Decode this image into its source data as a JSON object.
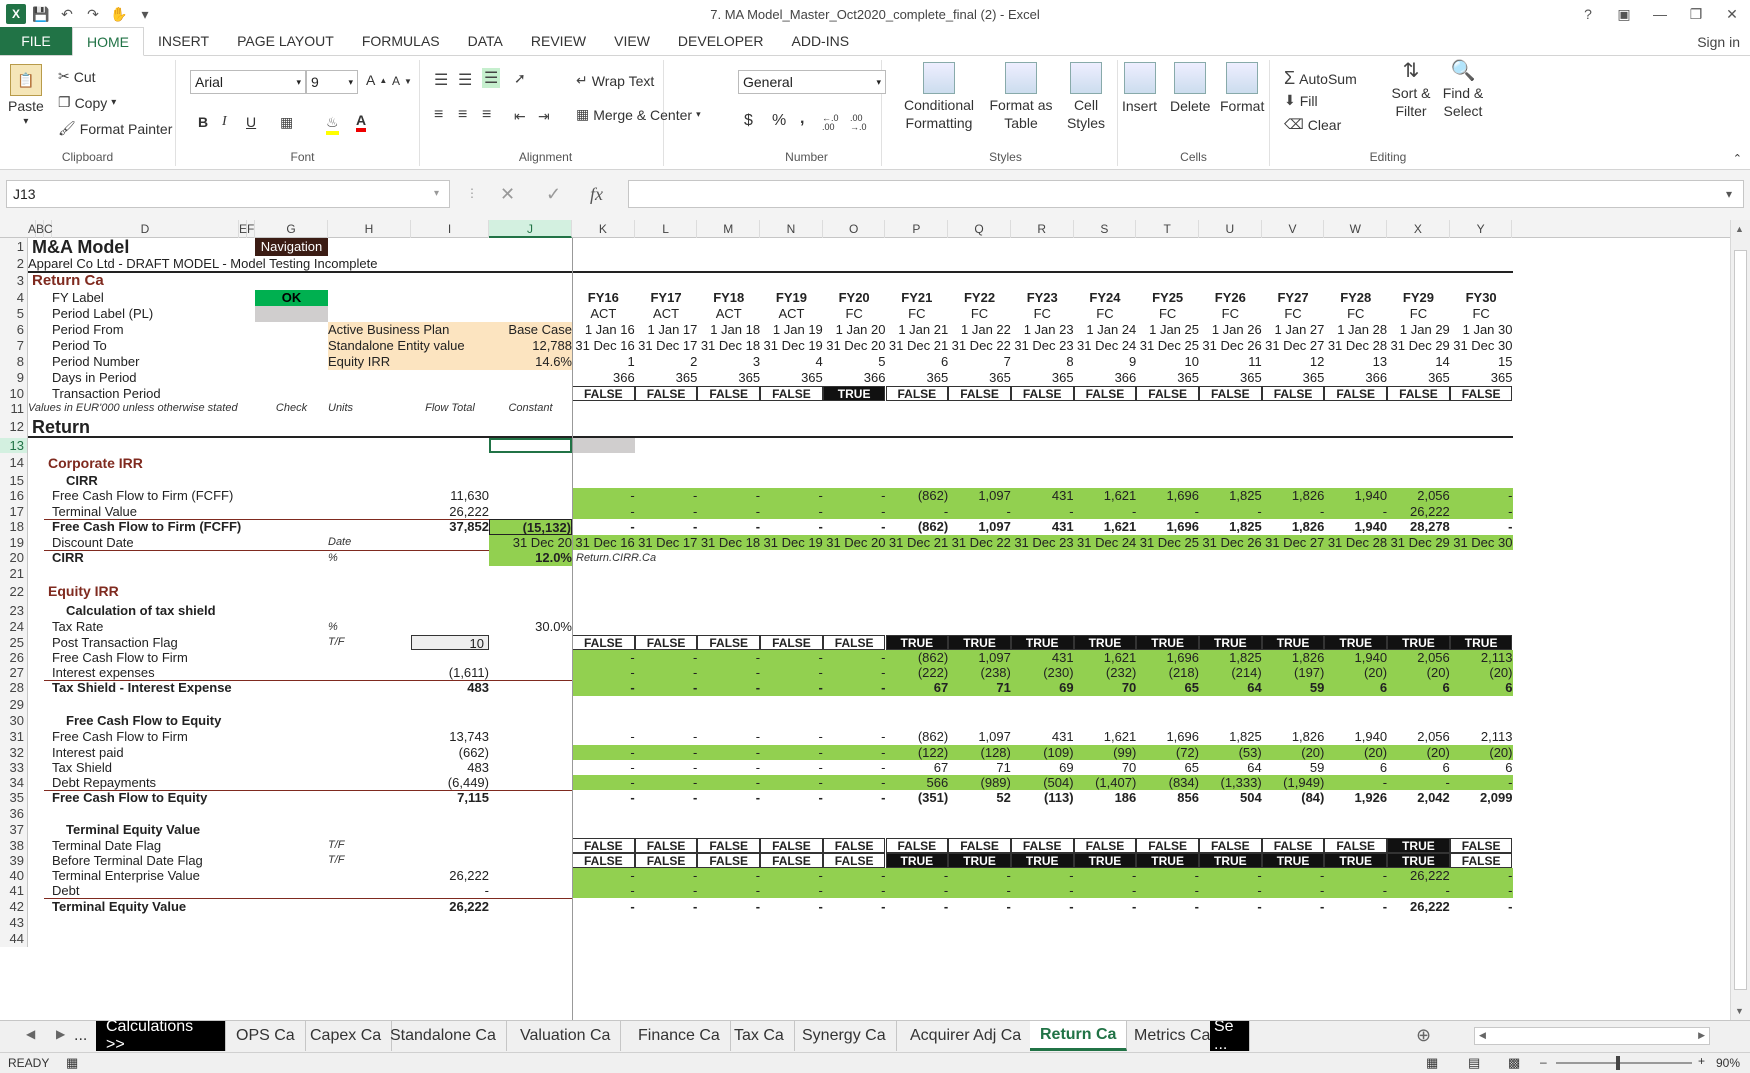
{
  "window": {
    "title": "7. MA Model_Master_Oct2020_complete_final (2) - Excel",
    "help": "?"
  },
  "ribbon_tabs": [
    "FILE",
    "HOME",
    "INSERT",
    "PAGE LAYOUT",
    "FORMULAS",
    "DATA",
    "REVIEW",
    "VIEW",
    "DEVELOPER",
    "ADD-INS"
  ],
  "sign_in": "Sign in",
  "ribbon": {
    "clipboard": {
      "paste": "Paste",
      "cut": "Cut",
      "copy": "Copy",
      "format_painter": "Format Painter",
      "label": "Clipboard"
    },
    "font": {
      "name": "Arial",
      "size": "9",
      "bold": "B",
      "italic": "I",
      "underline": "U",
      "grow": "A",
      "shrink": "A",
      "color_a": "A",
      "label": "Font"
    },
    "alignment": {
      "wrap": "Wrap Text",
      "merge": "Merge & Center",
      "label": "Alignment"
    },
    "number": {
      "format": "General",
      "currency": "$",
      "percent": "%",
      "comma": ",",
      "inc": "←.0 .00",
      "dec": ".00 →.0",
      "label": "Number"
    },
    "styles": {
      "cond": "Conditional Formatting",
      "format_table": "Format as Table",
      "cell_styles": "Cell Styles",
      "label": "Styles"
    },
    "cells": {
      "insert": "Insert",
      "delete": "Delete",
      "format": "Format",
      "label": "Cells"
    },
    "editing": {
      "autosum": "AutoSum",
      "fill": "Fill",
      "clear": "Clear",
      "sort": "Sort & Filter",
      "find": "Find & Select",
      "label": "Editing"
    }
  },
  "formula_bar": {
    "name_box": "J13",
    "formula": "",
    "fx": "fx"
  },
  "columns": [
    "A",
    "B",
    "C",
    "D",
    "E",
    "F",
    "G",
    "H",
    "I",
    "J",
    "K",
    "L",
    "M",
    "N",
    "O",
    "P",
    "Q",
    "R",
    "S",
    "T",
    "U",
    "V",
    "W",
    "X",
    "Y"
  ],
  "header": {
    "title": "M&A Model",
    "navigation": "Navigation",
    "subtitle": "Apparel Co Ltd - DRAFT MODEL - Model Testing Incomplete",
    "sheet": "Return Ca",
    "fy_label": "FY Label",
    "ok": "OK",
    "period_label": "Period Label (PL)",
    "period_from": "Period From",
    "period_to": "Period To",
    "period_number": "Period Number",
    "days_in_period": "Days in Period",
    "transaction_period": "Transaction Period",
    "active_bp": "Active Business Plan",
    "active_bp_val": "Base Case",
    "standalone": "Standalone Entity value",
    "standalone_val": "12,788",
    "equity_irr": "Equity IRR",
    "equity_irr_val": "14.6%",
    "values_note": "Values in EUR'000 unless otherwise stated",
    "check": "Check",
    "units": "Units",
    "flow_total": "Flow Total",
    "constant": "Constant"
  },
  "timeline": {
    "fy": [
      "FY16",
      "FY17",
      "FY18",
      "FY19",
      "FY20",
      "FY21",
      "FY22",
      "FY23",
      "FY24",
      "FY25",
      "FY26",
      "FY27",
      "FY28",
      "FY29",
      "FY30"
    ],
    "pl": [
      "ACT",
      "ACT",
      "ACT",
      "ACT",
      "FC",
      "FC",
      "FC",
      "FC",
      "FC",
      "FC",
      "FC",
      "FC",
      "FC",
      "FC",
      "FC"
    ],
    "from": [
      "1 Jan 16",
      "1 Jan 17",
      "1 Jan 18",
      "1 Jan 19",
      "1 Jan 20",
      "1 Jan 21",
      "1 Jan 22",
      "1 Jan 23",
      "1 Jan 24",
      "1 Jan 25",
      "1 Jan 26",
      "1 Jan 27",
      "1 Jan 28",
      "1 Jan 29",
      "1 Jan 30"
    ],
    "to": [
      "31 Dec 16",
      "31 Dec 17",
      "31 Dec 18",
      "31 Dec 19",
      "31 Dec 20",
      "31 Dec 21",
      "31 Dec 22",
      "31 Dec 23",
      "31 Dec 24",
      "31 Dec 25",
      "31 Dec 26",
      "31 Dec 27",
      "31 Dec 28",
      "31 Dec 29",
      "31 Dec 30"
    ],
    "num": [
      "1",
      "2",
      "3",
      "4",
      "5",
      "6",
      "7",
      "8",
      "9",
      "10",
      "11",
      "12",
      "13",
      "14",
      "15"
    ],
    "days": [
      "366",
      "365",
      "365",
      "365",
      "366",
      "365",
      "365",
      "365",
      "366",
      "365",
      "365",
      "365",
      "366",
      "365",
      "365"
    ],
    "trans": [
      "FALSE",
      "FALSE",
      "FALSE",
      "FALSE",
      "TRUE",
      "FALSE",
      "FALSE",
      "FALSE",
      "FALSE",
      "FALSE",
      "FALSE",
      "FALSE",
      "FALSE",
      "FALSE",
      "FALSE"
    ]
  },
  "section": {
    "return": "Return",
    "corp_irr": "Corporate IRR",
    "cirr": "CIRR",
    "equity_irr": "Equity IRR",
    "tax_shield_calc": "Calculation of tax shield",
    "fcfe": "Free Cash Flow to Equity",
    "tev": "Terminal Equity Value"
  },
  "corp": {
    "fcff_label": "Free Cash Flow to Firm (FCFF)",
    "fcff_total": "11,630",
    "fcff": [
      "-",
      "-",
      "-",
      "-",
      "-",
      "(862)",
      "1,097",
      "431",
      "1,621",
      "1,696",
      "1,825",
      "1,826",
      "1,940",
      "2,056",
      "-"
    ],
    "tv_label": "Terminal Value",
    "tv_total": "26,222",
    "tv": [
      "-",
      "-",
      "-",
      "-",
      "-",
      "-",
      "-",
      "-",
      "-",
      "-",
      "-",
      "-",
      "-",
      "26,222",
      "-"
    ],
    "fcff2_label": "Free Cash Flow to Firm (FCFF)",
    "fcff2_total": "37,852",
    "fcff2_const": "(15,132)",
    "fcff2": [
      "-",
      "-",
      "-",
      "-",
      "-",
      "(862)",
      "1,097",
      "431",
      "1,621",
      "1,696",
      "1,825",
      "1,826",
      "1,940",
      "28,278",
      "-"
    ],
    "dd_label": "Discount Date",
    "dd_unit": "Date",
    "dd_const": "31 Dec 20",
    "dd": [
      "31 Dec 16",
      "31 Dec 17",
      "31 Dec 18",
      "31 Dec 19",
      "31 Dec 20",
      "31 Dec 21",
      "31 Dec 22",
      "31 Dec 23",
      "31 Dec 24",
      "31 Dec 25",
      "31 Dec 26",
      "31 Dec 27",
      "31 Dec 28",
      "31 Dec 29",
      "31 Dec 30"
    ],
    "cirr_label": "CIRR",
    "cirr_unit": "%",
    "cirr_val": "12.0%",
    "cirr_name": "Return.CIRR.Ca"
  },
  "tax": {
    "rate_label": "Tax Rate",
    "rate_unit": "%",
    "rate_val": "30.0%",
    "ptf_label": "Post Transaction Flag",
    "ptf_unit": "T/F",
    "ptf_input": "10",
    "ptf": [
      "FALSE",
      "FALSE",
      "FALSE",
      "FALSE",
      "FALSE",
      "TRUE",
      "TRUE",
      "TRUE",
      "TRUE",
      "TRUE",
      "TRUE",
      "TRUE",
      "TRUE",
      "TRUE",
      "TRUE"
    ],
    "fcf_label": "Free Cash Flow to Firm",
    "fcf": [
      "-",
      "-",
      "-",
      "-",
      "-",
      "(862)",
      "1,097",
      "431",
      "1,621",
      "1,696",
      "1,825",
      "1,826",
      "1,940",
      "2,056",
      "2,113"
    ],
    "int_label": "Interest expenses",
    "int_total": "(1,611)",
    "int": [
      "-",
      "-",
      "-",
      "-",
      "-",
      "(222)",
      "(238)",
      "(230)",
      "(232)",
      "(218)",
      "(214)",
      "(197)",
      "(20)",
      "(20)",
      "(20)"
    ],
    "ts_label": "Tax Shield - Interest Expense",
    "ts_total": "483",
    "ts": [
      "-",
      "-",
      "-",
      "-",
      "-",
      "67",
      "71",
      "69",
      "70",
      "65",
      "64",
      "59",
      "6",
      "6",
      "6"
    ]
  },
  "fcfe": {
    "fcf_label": "Free Cash Flow to Firm",
    "fcf_total": "13,743",
    "fcf": [
      "-",
      "-",
      "-",
      "-",
      "-",
      "(862)",
      "1,097",
      "431",
      "1,621",
      "1,696",
      "1,825",
      "1,826",
      "1,940",
      "2,056",
      "2,113"
    ],
    "ip_label": "Interest paid",
    "ip_total": "(662)",
    "ip": [
      "-",
      "-",
      "-",
      "-",
      "-",
      "(122)",
      "(128)",
      "(109)",
      "(99)",
      "(72)",
      "(53)",
      "(20)",
      "(20)",
      "(20)",
      "(20)"
    ],
    "ts_label": "Tax Shield",
    "ts_total": "483",
    "ts": [
      "-",
      "-",
      "-",
      "-",
      "-",
      "67",
      "71",
      "69",
      "70",
      "65",
      "64",
      "59",
      "6",
      "6",
      "6"
    ],
    "dr_label": "Debt Repayments",
    "dr_total": "(6,449)",
    "dr": [
      "-",
      "-",
      "-",
      "-",
      "-",
      "566",
      "(989)",
      "(504)",
      "(1,407)",
      "(834)",
      "(1,333)",
      "(1,949)",
      "-",
      "-",
      "-"
    ],
    "fcfe_label": "Free Cash Flow to Equity",
    "fcfe_total": "7,115",
    "fcfe": [
      "-",
      "-",
      "-",
      "-",
      "-",
      "(351)",
      "52",
      "(113)",
      "186",
      "856",
      "504",
      "(84)",
      "1,926",
      "2,042",
      "2,099"
    ]
  },
  "tev": {
    "tdf_label": "Terminal Date Flag",
    "tdf_unit": "T/F",
    "tdf": [
      "FALSE",
      "FALSE",
      "FALSE",
      "FALSE",
      "FALSE",
      "FALSE",
      "FALSE",
      "FALSE",
      "FALSE",
      "FALSE",
      "FALSE",
      "FALSE",
      "FALSE",
      "TRUE",
      "FALSE"
    ],
    "btdf_label": "Before Terminal Date Flag",
    "btdf_unit": "T/F",
    "btdf": [
      "FALSE",
      "FALSE",
      "FALSE",
      "FALSE",
      "FALSE",
      "TRUE",
      "TRUE",
      "TRUE",
      "TRUE",
      "TRUE",
      "TRUE",
      "TRUE",
      "TRUE",
      "TRUE",
      "FALSE"
    ],
    "tent_label": "Terminal Enterprise Value",
    "tent_total": "26,222",
    "tent": [
      "-",
      "-",
      "-",
      "-",
      "-",
      "-",
      "-",
      "-",
      "-",
      "-",
      "-",
      "-",
      "-",
      "26,222",
      "-"
    ],
    "debt_label": "Debt",
    "debt_total": "-",
    "debt": [
      "-",
      "-",
      "-",
      "-",
      "-",
      "-",
      "-",
      "-",
      "-",
      "-",
      "-",
      "-",
      "-",
      "-",
      "-"
    ],
    "tev_label": "Terminal Equity Value",
    "tev_total": "26,222",
    "tev": [
      "-",
      "-",
      "-",
      "-",
      "-",
      "-",
      "-",
      "-",
      "-",
      "-",
      "-",
      "-",
      "-",
      "26,222",
      "-"
    ]
  },
  "sheet_tabs": [
    "...",
    "Calculations >>",
    "OPS Ca",
    "Capex Ca",
    "Standalone Ca",
    "Valuation Ca",
    "Finance Ca",
    "Tax Ca",
    "Synergy Ca",
    "Acquirer Adj Ca",
    "Return Ca",
    "Metrics Ca",
    "Se ..."
  ],
  "status": {
    "ready": "READY",
    "zoom": "90%"
  }
}
